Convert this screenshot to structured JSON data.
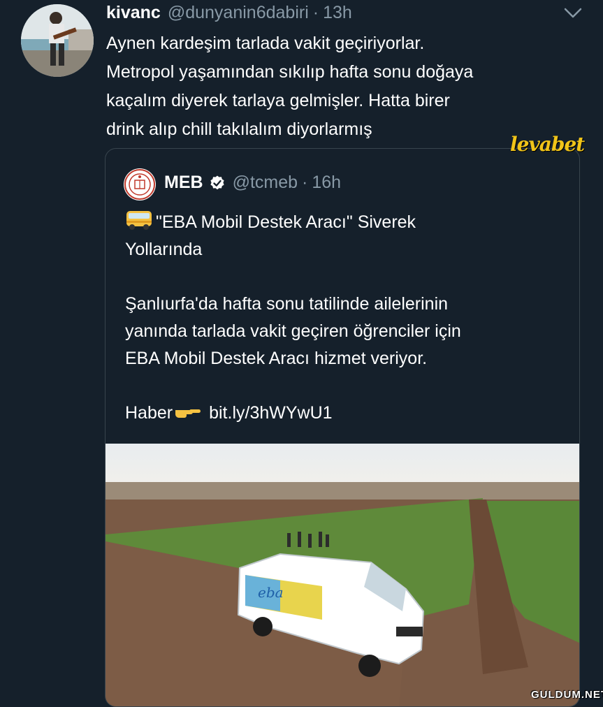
{
  "tweet": {
    "author_name": "kivanc",
    "handle": "@dunyanin6dabiri",
    "separator": "·",
    "time": "13h",
    "text_lines": [
      "Aynen kardeşim tarlada vakit geçiriyorlar.",
      "Metropol yaşamından sıkılıp hafta sonu doğaya",
      "kaçalım diyerek tarlaya gelmişler. Hatta birer",
      "drink alıp chill takılalım diyorlarmış"
    ]
  },
  "quoted_tweet": {
    "author_name": "MEB",
    "handle": "@tcmeb",
    "separator": "·",
    "time": "16h",
    "title_line1": "\"EBA Mobil Destek Aracı\" Siverek",
    "title_line2": "Yollarında",
    "body_lines": [
      "Şanlıurfa'da hafta sonu tatilinde ailelerinin",
      "yanında tarlada vakit geçiren öğrenciler için",
      "EBA Mobil Destek Aracı hizmet veriyor."
    ],
    "link_prefix": "Haber",
    "link": "bit.ly/3hWYwU1",
    "photo_van_text": "eba"
  },
  "watermarks": {
    "top": "levabet",
    "bottom": "GULDUM.NET"
  },
  "icons": {
    "avatar": "profile-photo",
    "chevron": "chevron-down-icon",
    "verified": "verified-badge-icon",
    "bus": "minibus-emoji-icon",
    "pointing": "pointing-hand-emoji-icon",
    "meb_logo": "meb-logo"
  },
  "colors": {
    "background": "#15202b",
    "secondary_text": "#8899a6",
    "border": "#38444d",
    "watermark_yellow": "#f0c419"
  }
}
